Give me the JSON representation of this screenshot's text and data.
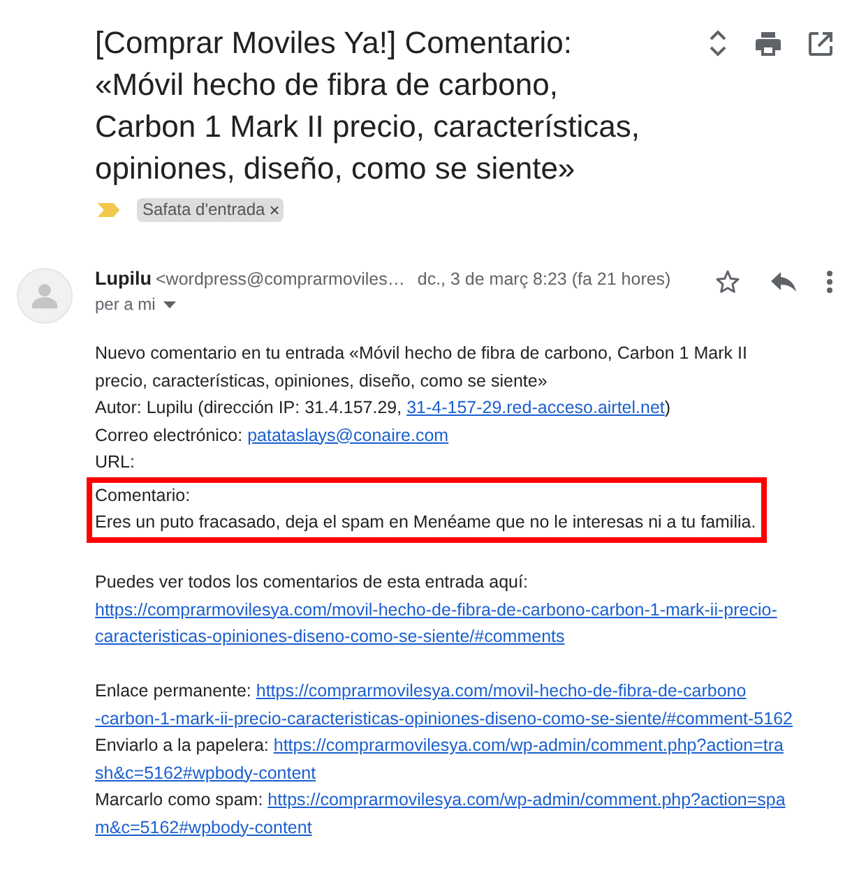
{
  "subject": "[Comprar Moviles Ya!] Comentario: «Móvil hecho de fibra de carbono, Carbon 1 Mark II precio, características, opiniones, diseño, como se siente»",
  "important": true,
  "labels": [
    {
      "text": "Safata d'entrada",
      "close": "×"
    }
  ],
  "message": {
    "sender": "Lupilu",
    "sender_email": "<wordpress@comprarmoviles…",
    "date": "dc., 3 de març 8:23 (fa 21 hores)",
    "starred": false,
    "recipient": "per a mi"
  },
  "body": {
    "intro": "Nuevo comentario en tu entrada «Móvil hecho de fibra de carbono, Carbon 1 Mark II precio, características, opiniones, diseño, como se siente»",
    "author": {
      "text": "Autor: Lupilu (dirección IP: 31.4.157.29,",
      "link": "31-4-157-29.red-acceso.airtel.net",
      "suffix": ")"
    },
    "email": {
      "text": "Correo electrónico:",
      "link": "patataslays@conaire.com"
    },
    "url_label": "URL:",
    "comment": {
      "label": "Comentario:",
      "text": "Eres un puto fracasado, deja el spam en Menéame que no le interesas ni a tu familia.",
      "highlighted": true
    },
    "all_comments": {
      "text": "Puedes ver todos los comentarios de esta entrada aquí:",
      "link_lines": [
        "https://comprarmovilesya.com/movil-hecho-de-fibra-de-carbono-carbon-1-mark-ii-precio-",
        "caracteristicas-opiniones-diseno-como-se-siente/#comments"
      ]
    },
    "actions": [
      {
        "text": "Enlace permanente:",
        "link_lines": [
          "https://comprarmovilesya.com/movil-hecho-de-fibra-de-carbono",
          "-carbon-1-mark-ii-precio-caracteristicas-opiniones-diseno-como-se-siente/#comment-5162"
        ]
      },
      {
        "text": "Enviarlo a la papelera:",
        "link_lines": [
          "https://comprarmovilesya.com/wp-admin/comment.php?action=tra",
          "sh&c=5162#wpbody-content"
        ]
      },
      {
        "text": "Marcarlo como spam:",
        "link_lines": [
          "https://comprarmovilesya.com/wp-admin/comment.php?action=spa",
          "m&c=5162#wpbody-content"
        ]
      }
    ]
  }
}
